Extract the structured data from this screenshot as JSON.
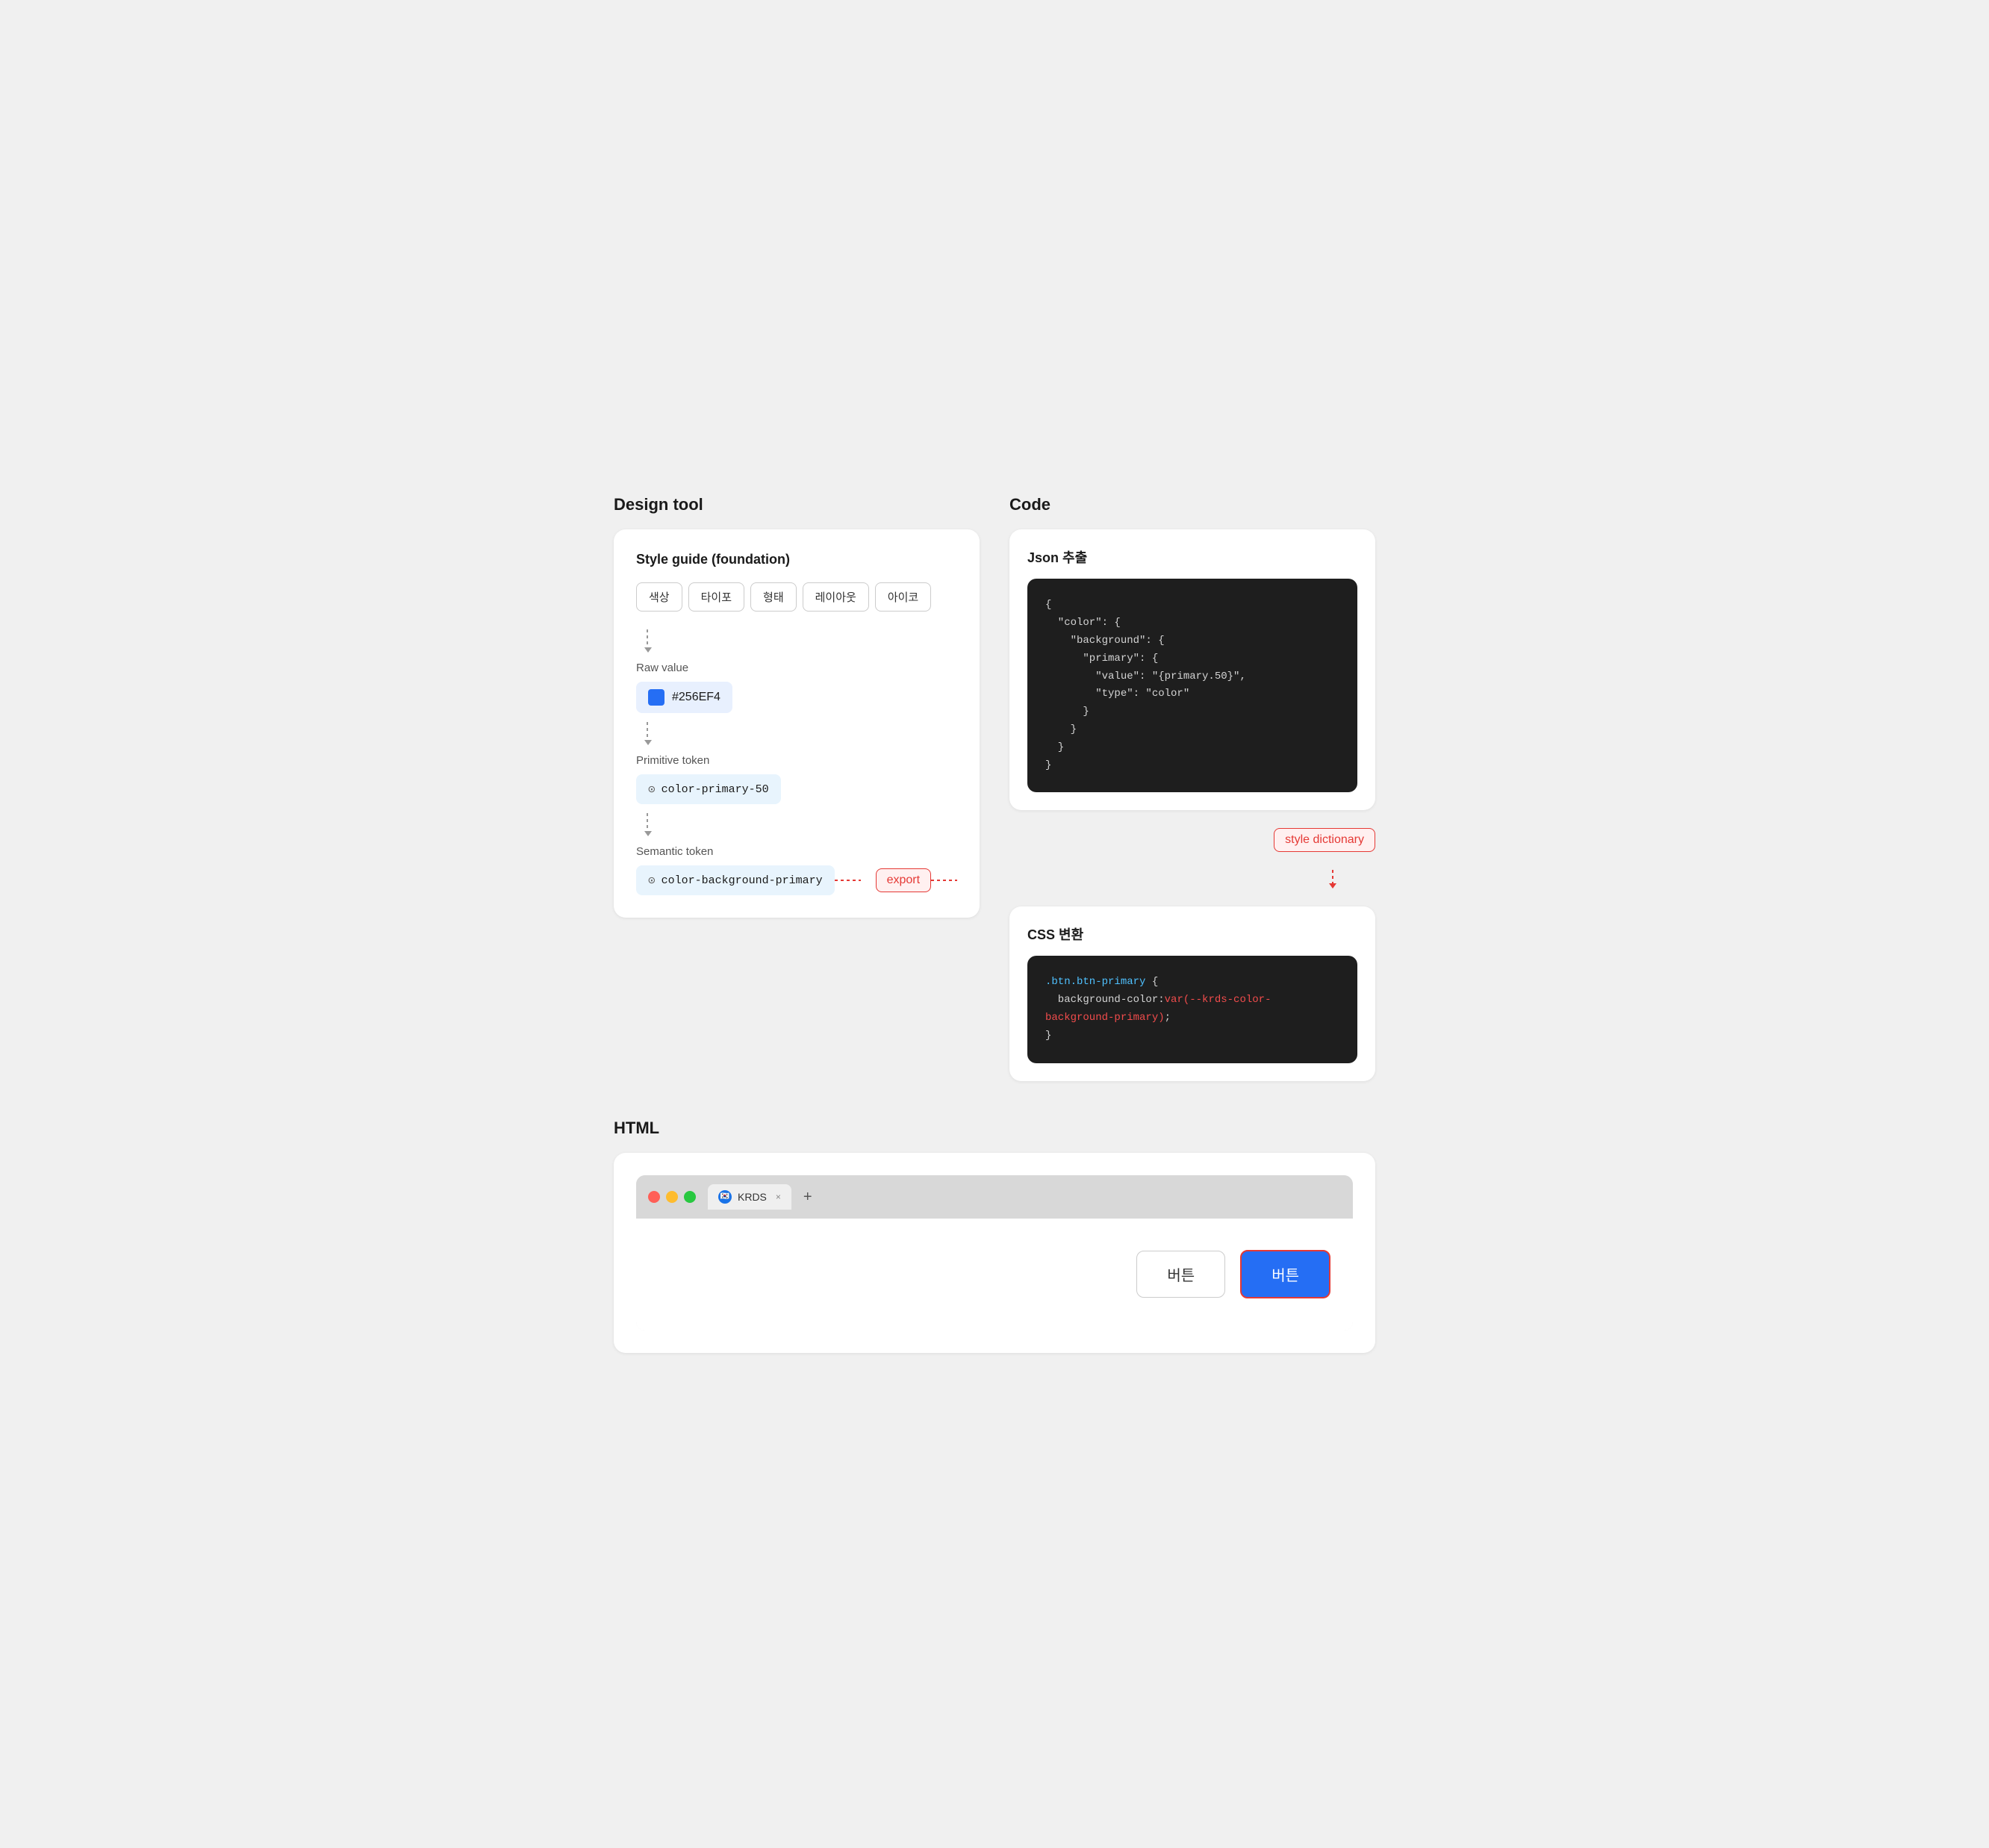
{
  "sections": {
    "design_tool_title": "Design tool",
    "code_title": "Code",
    "html_title": "HTML"
  },
  "design_panel": {
    "title": "Style guide (foundation)",
    "tabs": [
      "색상",
      "타이포",
      "형태",
      "레이아웃",
      "아이코"
    ],
    "raw_value_label": "Raw value",
    "raw_value": "#256EF4",
    "primitive_token_label": "Primitive token",
    "primitive_token": "color-primary-50",
    "semantic_token_label": "Semantic token",
    "semantic_token": "color-background-primary",
    "export_label": "export"
  },
  "code_panel": {
    "json_title": "Json 추출",
    "json_lines": [
      "{",
      "  \"color\": {",
      "    \"background\": {",
      "      \"primary\": {",
      "        \"value\": \"{primary.50}\",",
      "        \"type\": \"color\"",
      "      }",
      "    }",
      "  }",
      "}"
    ],
    "style_dictionary_label": "style dictionary",
    "css_title": "CSS 변환",
    "css_selector": ".btn.btn-primary",
    "css_property": "background-color:",
    "css_value": "var(--krds-color-background-primary);",
    "css_close": "}"
  },
  "browser": {
    "tab_label": "KRDS",
    "btn_outline_label": "버튼",
    "btn_primary_label": "버튼"
  }
}
